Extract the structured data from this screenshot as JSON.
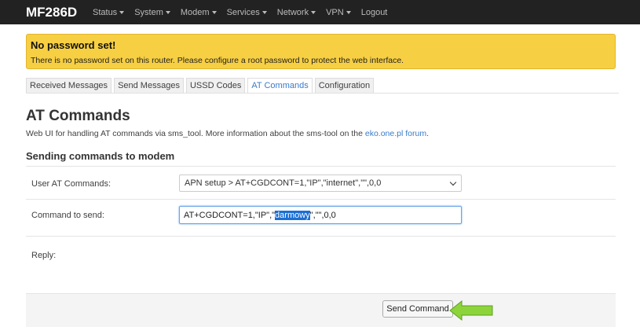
{
  "header": {
    "brand": "MF286D",
    "menu": [
      {
        "label": "Status",
        "dropdown": true
      },
      {
        "label": "System",
        "dropdown": true
      },
      {
        "label": "Modem",
        "dropdown": true
      },
      {
        "label": "Services",
        "dropdown": true
      },
      {
        "label": "Network",
        "dropdown": true
      },
      {
        "label": "VPN",
        "dropdown": true
      },
      {
        "label": "Logout",
        "dropdown": false
      }
    ]
  },
  "alert": {
    "title": "No password set!",
    "text": "There is no password set on this router. Please configure a root password to protect the web interface."
  },
  "tabs": [
    {
      "label": "Received Messages",
      "active": false
    },
    {
      "label": "Send Messages",
      "active": false
    },
    {
      "label": "USSD Codes",
      "active": false
    },
    {
      "label": "AT Commands",
      "active": true
    },
    {
      "label": "Configuration",
      "active": false
    }
  ],
  "page": {
    "title": "AT Commands",
    "description_prefix": "Web UI for handling AT commands via sms_tool. More information about the sms-tool on the ",
    "description_link": "eko.one.pl forum",
    "description_suffix": "."
  },
  "section": {
    "title": "Sending commands to modem",
    "user_at_commands_label": "User AT Commands:",
    "user_at_commands_value": "APN setup > AT+CGDCONT=1,\"IP\",\"internet\",\"\",0,0",
    "command_label": "Command to send:",
    "command_before": "AT+CGDCONT=1,\"IP\",\"",
    "command_selected": "darmowy",
    "command_after": "\",\"\",0,0",
    "reply_label": "Reply:"
  },
  "actions": {
    "send_label": "Send Command"
  },
  "colors": {
    "topbar": "#222222",
    "alert": "#f7cf42",
    "link": "#3a7bc8",
    "arrow": "#8cd43a"
  }
}
